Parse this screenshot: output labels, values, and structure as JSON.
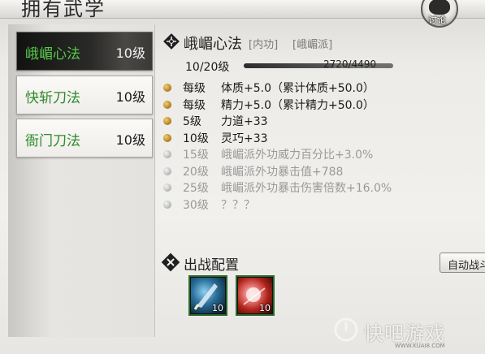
{
  "header": {
    "title": "拥有武学",
    "discuss_label": "讨论"
  },
  "skills": [
    {
      "name": "峨嵋心法",
      "level": "10级",
      "active": true
    },
    {
      "name": "快斩刀法",
      "level": "10级",
      "active": false
    },
    {
      "name": "衙门刀法",
      "level": "10级",
      "active": false
    }
  ],
  "detail": {
    "name": "峨嵋心法",
    "tags": [
      "[内功]",
      "[峨嵋派]"
    ],
    "level_text": "10/20级",
    "exp_text": "2720/4490",
    "exp_fraction": 0.606
  },
  "bonuses": [
    {
      "level": "每级",
      "effect": "体质+5.0（累计体质+50.0）",
      "unlocked": true
    },
    {
      "level": "每级",
      "effect": "精力+5.0（累计精力+50.0）",
      "unlocked": true
    },
    {
      "level": "5级",
      "effect": "力道+33",
      "unlocked": true
    },
    {
      "level": "10级",
      "effect": "灵巧+33",
      "unlocked": true
    },
    {
      "level": "15级",
      "effect": "峨嵋派外功威力百分比+3.0%",
      "unlocked": false
    },
    {
      "level": "20级",
      "effect": "峨嵋派外功暴击值+788",
      "unlocked": false
    },
    {
      "level": "25级",
      "effect": "峨嵋派外功暴击伤害倍数+16.0%",
      "unlocked": false
    },
    {
      "level": "30级",
      "effect": "？？？",
      "unlocked": false
    }
  ],
  "battle_config": {
    "title": "出战配置",
    "auto_button": "自动战斗",
    "slots": [
      {
        "count": "10"
      },
      {
        "count": "10"
      }
    ]
  },
  "watermark": {
    "text": "快吧游戏",
    "url": "WWW.KUAI8.COM"
  },
  "colors": {
    "skill_name": "#2e8a2a",
    "skill_name_active": "#58c84a",
    "bullet_unlocked": "#c9962f",
    "locked_text": "#9a9a9a"
  }
}
